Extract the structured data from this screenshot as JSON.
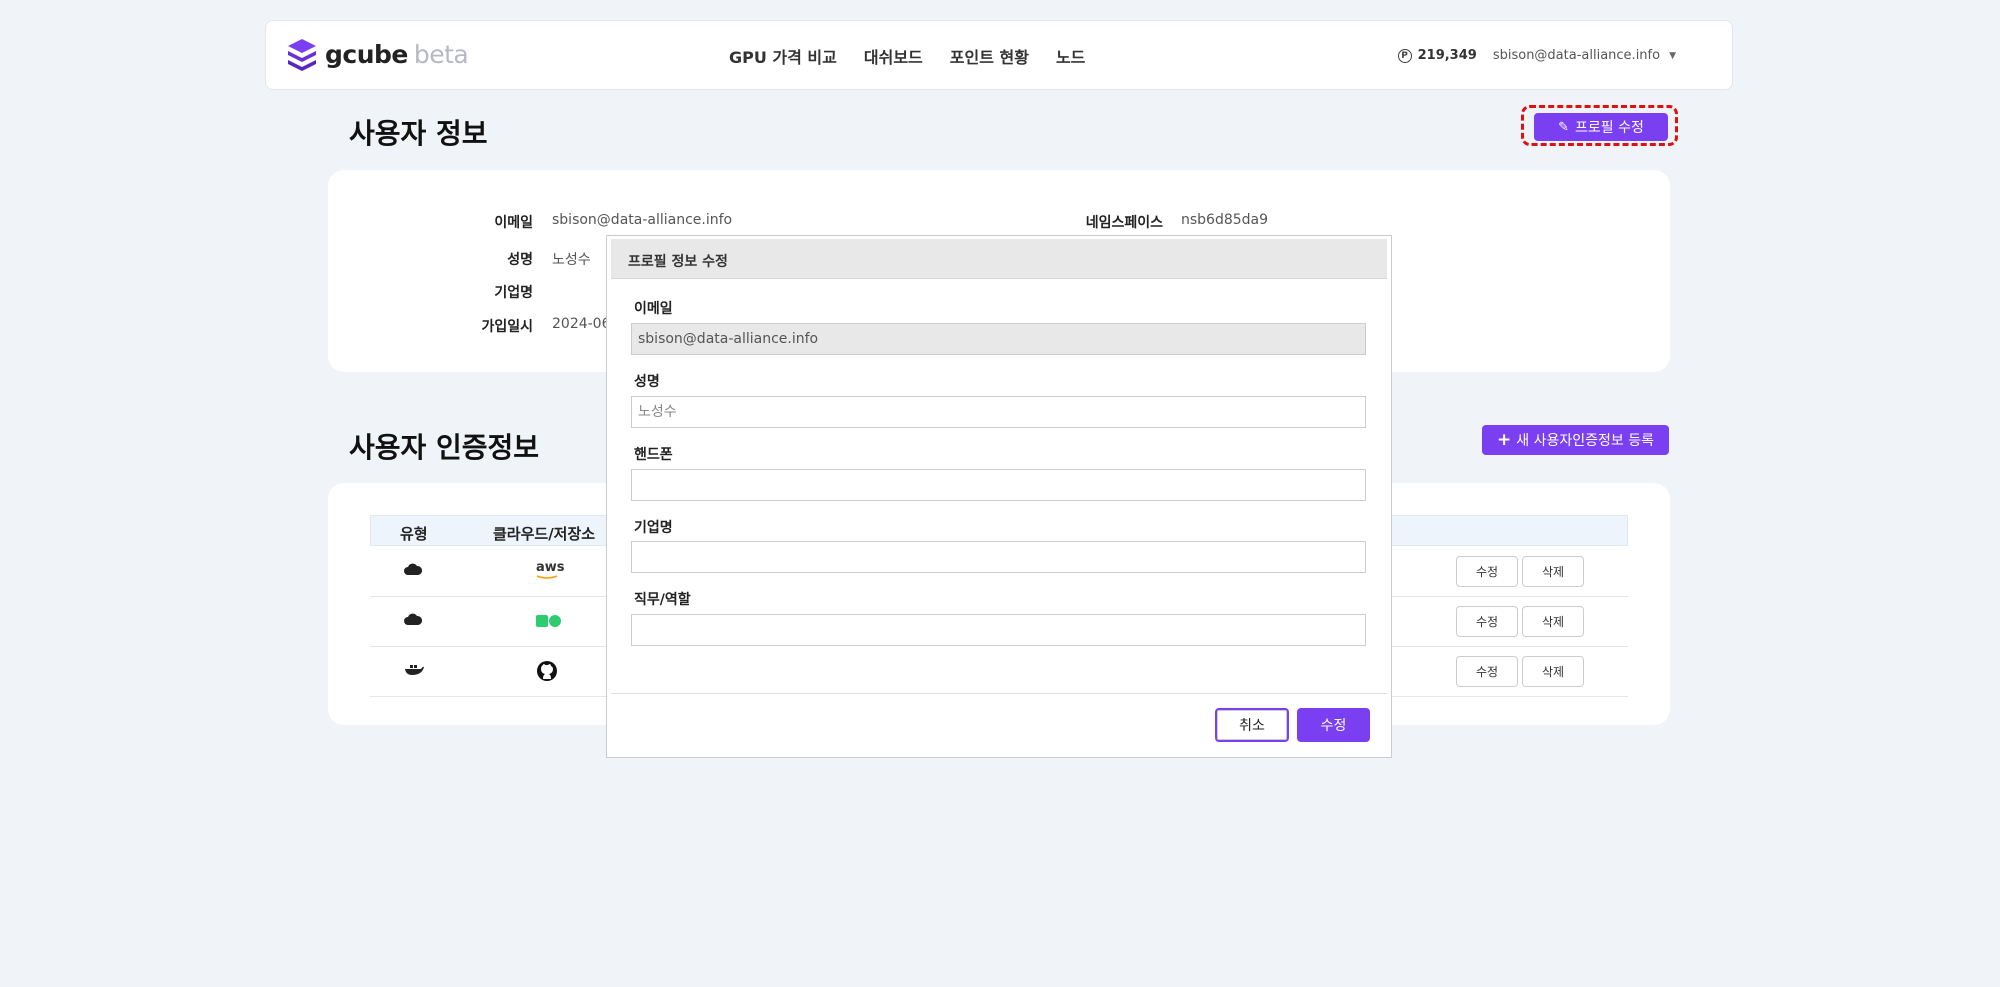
{
  "navbar": {
    "logo_main": "gcube",
    "logo_sub": "beta",
    "links": [
      "GPU 가격 비교",
      "대쉬보드",
      "포인트 현황",
      "노드"
    ],
    "points": "219,349",
    "point_icon": "P",
    "user_email": "sbison@data-alliance.info"
  },
  "user_info": {
    "title": "사용자 정보",
    "edit_button": "프로필 수정",
    "fields": [
      {
        "label": "이메일",
        "value": "sbison@data-alliance.info"
      },
      {
        "label": "성명",
        "value": "노성수"
      },
      {
        "label": "기업명",
        "value": ""
      },
      {
        "label": "가입일시",
        "value": "2024-06"
      }
    ],
    "namespace_label": "네임스페이스",
    "namespace_value": "nsb6d85da9"
  },
  "credentials": {
    "title": "사용자 인증정보",
    "new_button": "새 사용자인증정보 등록",
    "columns": [
      "유형",
      "클라우드/저장소"
    ],
    "rows": [
      {
        "type_icon": "cloud-icon",
        "provider_icon": "aws-logo",
        "provider_text": "aws",
        "edit": "수정",
        "delete": "삭제"
      },
      {
        "type_icon": "cloud-icon",
        "provider_icon": "green-squares-logo",
        "edit": "수정",
        "delete": "삭제"
      },
      {
        "type_icon": "docker-icon",
        "provider_icon": "github-icon",
        "edit": "수정",
        "delete": "삭제"
      }
    ]
  },
  "modal": {
    "title": "프로필 정보 수정",
    "fields": [
      {
        "label": "이메일",
        "value": "sbison@data-alliance.info",
        "placeholder": "",
        "disabled": true
      },
      {
        "label": "성명",
        "value": "",
        "placeholder": "노성수"
      },
      {
        "label": "핸드폰",
        "value": "",
        "placeholder": ""
      },
      {
        "label": "기업명",
        "value": "",
        "placeholder": ""
      },
      {
        "label": "직무/역할",
        "value": "",
        "placeholder": ""
      }
    ],
    "cancel": "취소",
    "submit": "수정"
  },
  "colors": {
    "accent": "#7b3ff2",
    "highlight": "#dd1111",
    "background": "#f0f3f8"
  }
}
